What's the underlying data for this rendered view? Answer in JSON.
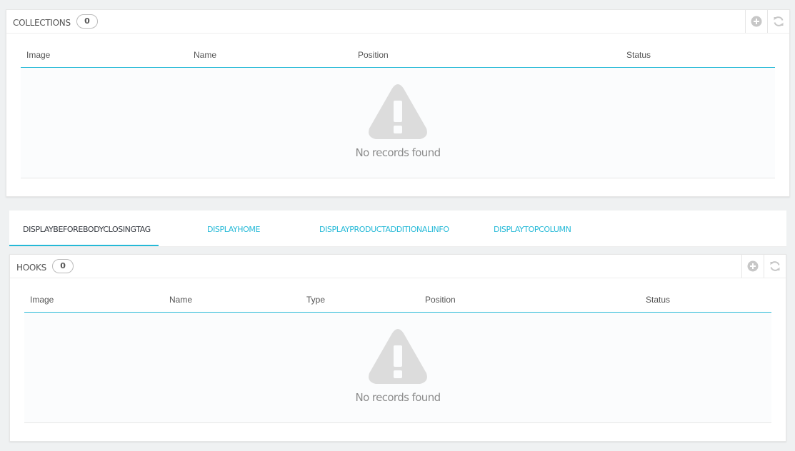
{
  "collections_panel": {
    "title": "COLLECTIONS",
    "count": "0",
    "actions": [
      {
        "icon": "plus-circle-icon"
      },
      {
        "icon": "refresh-icon"
      }
    ],
    "columns": [
      "Image",
      "Name",
      "Position",
      "Status"
    ],
    "empty_message": "No records found"
  },
  "hook_tabs": [
    {
      "label": "DISPLAYBEFOREBODYCLOSINGTAG",
      "active": true
    },
    {
      "label": "DISPLAYHOME",
      "active": false
    },
    {
      "label": "DISPLAYPRODUCTADDITIONALINFO",
      "active": false
    },
    {
      "label": "DISPLAYTOPCOLUMN",
      "active": false
    }
  ],
  "hooks_panel": {
    "title": "HOOKS",
    "count": "0",
    "actions": [
      {
        "icon": "plus-circle-icon"
      },
      {
        "icon": "refresh-icon"
      }
    ],
    "columns": [
      "Image",
      "Name",
      "Type",
      "Position",
      "Status"
    ],
    "empty_message": "No records found"
  },
  "colors": {
    "accent": "#25b9d7",
    "icon_gray": "#c7c7c7",
    "page_bg": "#eff1f2"
  }
}
